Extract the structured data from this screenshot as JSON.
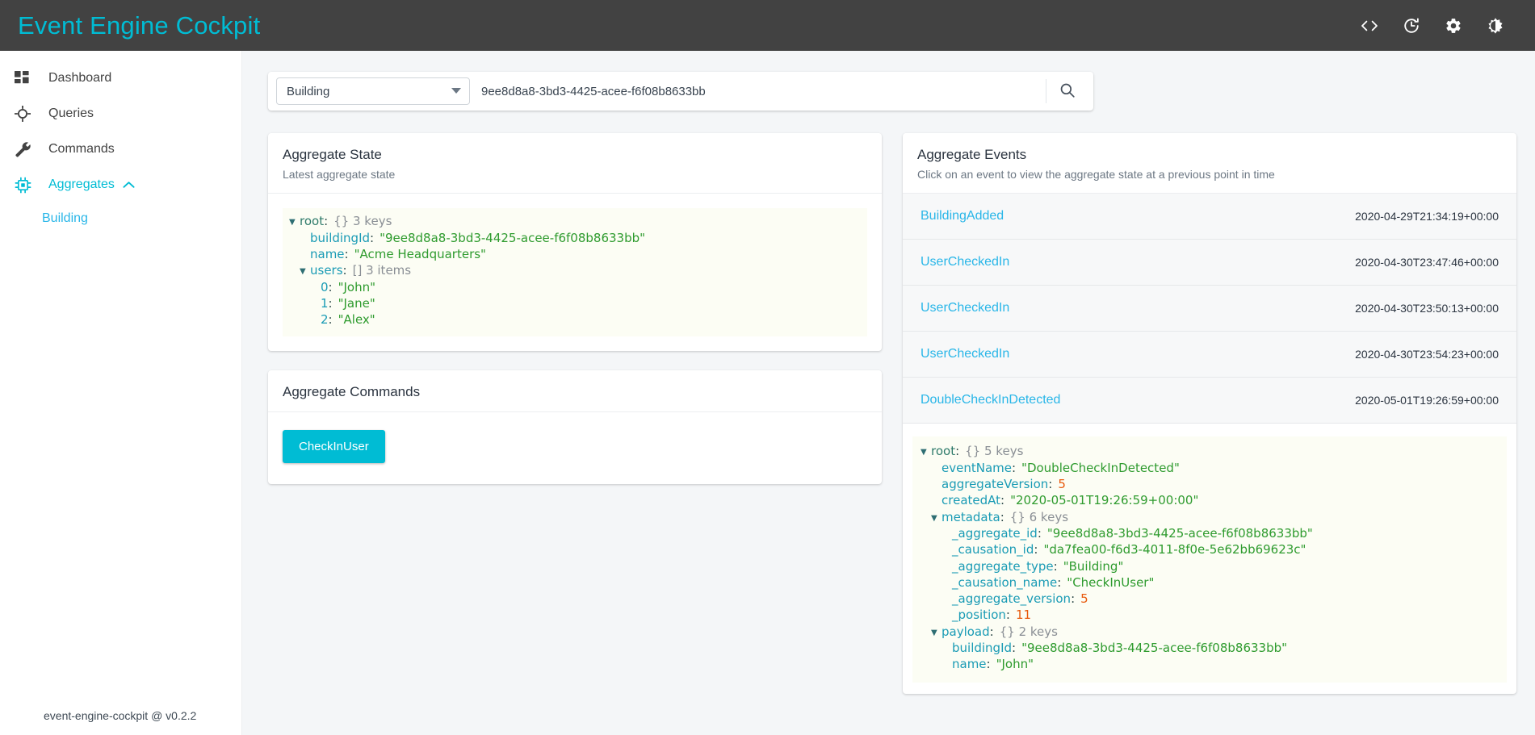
{
  "app": {
    "title": "Event Engine Cockpit",
    "footer": "event-engine-cockpit @ v0.2.2",
    "accent": "#00bcd4",
    "topbar_bg": "#424242"
  },
  "topbar": {
    "icons": [
      {
        "name": "code-icon",
        "label": "<>"
      },
      {
        "name": "history-clock-icon",
        "label": "history"
      },
      {
        "name": "gear-icon",
        "label": "settings"
      },
      {
        "name": "brightness-toggle-icon",
        "label": "theme"
      }
    ]
  },
  "sidebar": {
    "items": [
      {
        "label": "Dashboard",
        "icon": "dashboard-grid-icon",
        "active": false
      },
      {
        "label": "Queries",
        "icon": "target-crosshair-icon",
        "active": false
      },
      {
        "label": "Commands",
        "icon": "wrench-icon",
        "active": false
      },
      {
        "label": "Aggregates",
        "icon": "chip-icon",
        "active": true,
        "expanded": true
      }
    ],
    "sub_items": [
      {
        "label": "Building",
        "parent": "Aggregates"
      }
    ]
  },
  "search": {
    "selected_type": "Building",
    "options": [
      "Building"
    ],
    "value": "9ee8d8a8-3bd3-4425-acee-f6f08b8633bb",
    "placeholder": "",
    "button_icon": "search-icon"
  },
  "aggregate_state": {
    "title": "Aggregate State",
    "subtitle": "Latest aggregate state",
    "tree": [
      {
        "indent": 0,
        "arrow": "▼",
        "key": "root",
        "keyclass": "jkey-root",
        "meta": "{}  3 keys"
      },
      {
        "indent": 1,
        "arrow": "",
        "key": "buildingId",
        "keyclass": "jkey",
        "value": "\"9ee8d8a8-3bd3-4425-acee-f6f08b8633bb\"",
        "valclass": "jstr"
      },
      {
        "indent": 1,
        "arrow": "",
        "key": "name",
        "keyclass": "jkey",
        "value": "\"Acme Headquarters\"",
        "valclass": "jstr"
      },
      {
        "indent": 1,
        "arrow": "▼",
        "key": "users",
        "keyclass": "jkey",
        "meta": "[]  3 items"
      },
      {
        "indent": 2,
        "arrow": "",
        "key": "0",
        "keyclass": "jkey",
        "value": "\"John\"",
        "valclass": "jstr"
      },
      {
        "indent": 2,
        "arrow": "",
        "key": "1",
        "keyclass": "jkey",
        "value": "\"Jane\"",
        "valclass": "jstr"
      },
      {
        "indent": 2,
        "arrow": "",
        "key": "2",
        "keyclass": "jkey",
        "value": "\"Alex\"",
        "valclass": "jstr"
      }
    ]
  },
  "aggregate_commands": {
    "title": "Aggregate Commands",
    "buttons": [
      {
        "label": "CheckInUser"
      }
    ]
  },
  "aggregate_events": {
    "title": "Aggregate Events",
    "subtitle": "Click on an event to view the aggregate state at a previous point in time",
    "rows": [
      {
        "name": "BuildingAdded",
        "time": "2020-04-29T21:34:19+00:00"
      },
      {
        "name": "UserCheckedIn",
        "time": "2020-04-30T23:47:46+00:00"
      },
      {
        "name": "UserCheckedIn",
        "time": "2020-04-30T23:50:13+00:00"
      },
      {
        "name": "UserCheckedIn",
        "time": "2020-04-30T23:54:23+00:00"
      },
      {
        "name": "DoubleCheckInDetected",
        "time": "2020-05-01T19:26:59+00:00"
      }
    ],
    "detail_tree": [
      {
        "indent": 0,
        "arrow": "▼",
        "key": "root",
        "keyclass": "jkey-root",
        "meta": "{}  5 keys"
      },
      {
        "indent": 1,
        "arrow": "",
        "key": "eventName",
        "keyclass": "jkey",
        "value": "\"DoubleCheckInDetected\"",
        "valclass": "jstr"
      },
      {
        "indent": 1,
        "arrow": "",
        "key": "aggregateVersion",
        "keyclass": "jkey",
        "value": "5",
        "valclass": "jnum"
      },
      {
        "indent": 1,
        "arrow": "",
        "key": "createdAt",
        "keyclass": "jkey",
        "value": "\"2020-05-01T19:26:59+00:00\"",
        "valclass": "jstr"
      },
      {
        "indent": 1,
        "arrow": "▼",
        "key": "metadata",
        "keyclass": "jkey",
        "meta": "{}  6 keys"
      },
      {
        "indent": 2,
        "arrow": "",
        "key": "_aggregate_id",
        "keyclass": "jkey",
        "value": "\"9ee8d8a8-3bd3-4425-acee-f6f08b8633bb\"",
        "valclass": "jstr"
      },
      {
        "indent": 2,
        "arrow": "",
        "key": "_causation_id",
        "keyclass": "jkey",
        "value": "\"da7fea00-f6d3-4011-8f0e-5e62bb69623c\"",
        "valclass": "jstr"
      },
      {
        "indent": 2,
        "arrow": "",
        "key": "_aggregate_type",
        "keyclass": "jkey",
        "value": "\"Building\"",
        "valclass": "jstr"
      },
      {
        "indent": 2,
        "arrow": "",
        "key": "_causation_name",
        "keyclass": "jkey",
        "value": "\"CheckInUser\"",
        "valclass": "jstr"
      },
      {
        "indent": 2,
        "arrow": "",
        "key": "_aggregate_version",
        "keyclass": "jkey",
        "value": "5",
        "valclass": "jnum"
      },
      {
        "indent": 2,
        "arrow": "",
        "key": "_position",
        "keyclass": "jkey",
        "value": "11",
        "valclass": "jnum"
      },
      {
        "indent": 1,
        "arrow": "▼",
        "key": "payload",
        "keyclass": "jkey",
        "meta": "{}  2 keys"
      },
      {
        "indent": 2,
        "arrow": "",
        "key": "buildingId",
        "keyclass": "jkey",
        "value": "\"9ee8d8a8-3bd3-4425-acee-f6f08b8633bb\"",
        "valclass": "jstr"
      },
      {
        "indent": 2,
        "arrow": "",
        "key": "name",
        "keyclass": "jkey",
        "value": "\"John\"",
        "valclass": "jstr"
      }
    ]
  }
}
